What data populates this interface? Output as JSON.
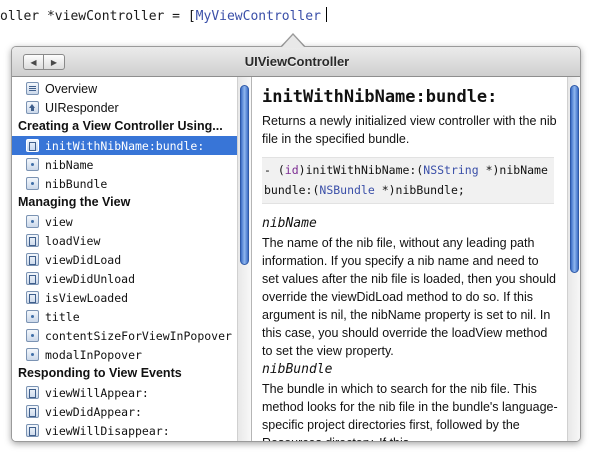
{
  "editor": {
    "code_prefix": "oller *viewController = [",
    "code_class": "MyViewController"
  },
  "popover": {
    "title": "UIViewController",
    "nav": {
      "back": "◀",
      "forward": "▶"
    }
  },
  "sidebar": {
    "items": [
      {
        "kind": "item",
        "icon": "overview",
        "icon_name": "overview-icon",
        "label": "Overview",
        "mono": false,
        "selected": false
      },
      {
        "kind": "item",
        "icon": "super",
        "icon_name": "superclass-icon",
        "label": "UIResponder",
        "mono": false,
        "selected": false
      },
      {
        "kind": "header",
        "label": "Creating a View Controller Using..."
      },
      {
        "kind": "item",
        "icon": "method",
        "icon_name": "method-icon",
        "label": "initWithNibName:bundle:",
        "mono": true,
        "selected": true
      },
      {
        "kind": "item",
        "icon": "prop",
        "icon_name": "property-icon",
        "label": "nibName",
        "mono": true,
        "selected": false
      },
      {
        "kind": "item",
        "icon": "prop",
        "icon_name": "property-icon",
        "label": "nibBundle",
        "mono": true,
        "selected": false
      },
      {
        "kind": "header",
        "label": "Managing the View"
      },
      {
        "kind": "item",
        "icon": "prop",
        "icon_name": "property-icon",
        "label": "view",
        "mono": true,
        "selected": false
      },
      {
        "kind": "item",
        "icon": "method",
        "icon_name": "method-icon",
        "label": "loadView",
        "mono": true,
        "selected": false
      },
      {
        "kind": "item",
        "icon": "method",
        "icon_name": "method-icon",
        "label": "viewDidLoad",
        "mono": true,
        "selected": false
      },
      {
        "kind": "item",
        "icon": "method",
        "icon_name": "method-icon",
        "label": "viewDidUnload",
        "mono": true,
        "selected": false
      },
      {
        "kind": "item",
        "icon": "method",
        "icon_name": "method-icon",
        "label": "isViewLoaded",
        "mono": true,
        "selected": false
      },
      {
        "kind": "item",
        "icon": "prop",
        "icon_name": "property-icon",
        "label": "title",
        "mono": true,
        "selected": false
      },
      {
        "kind": "item",
        "icon": "prop",
        "icon_name": "property-icon",
        "label": "contentSizeForViewInPopover",
        "mono": true,
        "selected": false
      },
      {
        "kind": "item",
        "icon": "prop",
        "icon_name": "property-icon",
        "label": "modalInPopover",
        "mono": true,
        "selected": false
      },
      {
        "kind": "header",
        "label": "Responding to View Events"
      },
      {
        "kind": "item",
        "icon": "method",
        "icon_name": "method-icon",
        "label": "viewWillAppear:",
        "mono": true,
        "selected": false
      },
      {
        "kind": "item",
        "icon": "method",
        "icon_name": "method-icon",
        "label": "viewDidAppear:",
        "mono": true,
        "selected": false
      },
      {
        "kind": "item",
        "icon": "method",
        "icon_name": "method-icon",
        "label": "viewWillDisappear:",
        "mono": true,
        "selected": false
      }
    ]
  },
  "content": {
    "method_title": "initWithNibName:bundle:",
    "abstract": "Returns a newly initialized view controller with the nib file in the specified bundle.",
    "declaration": {
      "prefix": "- (",
      "return_type": "id",
      "sel1": ")initWithNibName:(",
      "type1": "NSString",
      "after_type1": " *)nibName",
      "sel2": "bundle:(",
      "type2": "NSBundle",
      "after_type2": " *)nibBundle;"
    },
    "params": [
      {
        "name": "nibName",
        "desc": "The name of the nib file, without any leading path information. If you specify a nib name and need to set values after the nib file is loaded, then you should override the viewDidLoad method to do so. If this argument is nil, the nibName property is set to nil. In this case, you should override the loadView method to set the view property."
      },
      {
        "name": "nibBundle",
        "desc": "The bundle in which to search for the nib file. This method looks for the nib file in the bundle's language-specific project directories first, followed by the Resources directory. If this"
      }
    ]
  },
  "colors": {
    "selection": "#3875d7",
    "keyword": "#7b2b92",
    "type": "#3a4fa8"
  }
}
